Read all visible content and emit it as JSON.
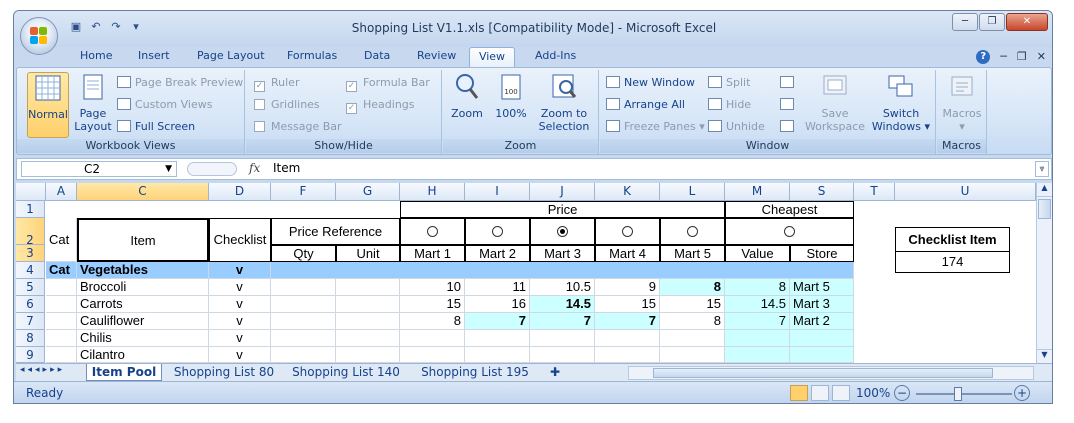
{
  "window": {
    "title": "Shopping List V1.1.xls  [Compatibility Mode] - Microsoft Excel",
    "controls": {
      "minimize": "─",
      "restore": "❐",
      "close": "✕"
    }
  },
  "tabs": [
    "Home",
    "Insert",
    "Page Layout",
    "Formulas",
    "Data",
    "Review",
    "View",
    "Add-Ins"
  ],
  "active_tab": "View",
  "ribbon": {
    "workbook_views": {
      "label": "Workbook Views",
      "normal": "Normal",
      "page_layout": "Page Layout",
      "page_break_preview": "Page Break Preview",
      "custom_views": "Custom Views",
      "full_screen": "Full Screen"
    },
    "show_hide": {
      "label": "Show/Hide",
      "ruler": "Ruler",
      "formula_bar": "Formula Bar",
      "gridlines": "Gridlines",
      "headings": "Headings",
      "message_bar": "Message Bar"
    },
    "zoom": {
      "label": "Zoom",
      "zoom": "Zoom",
      "hundred": "100%",
      "zoom_to_selection": "Zoom to Selection"
    },
    "window": {
      "label": "Window",
      "new_window": "New Window",
      "arrange_all": "Arrange All",
      "freeze_panes": "Freeze Panes",
      "split": "Split",
      "hide": "Hide",
      "unhide": "Unhide",
      "save_workspace": "Save Workspace",
      "switch_windows": "Switch Windows"
    },
    "macros": {
      "label": "Macros",
      "macros": "Macros"
    }
  },
  "formula_bar": {
    "name_box": "C2",
    "fx": "fx",
    "value": "Item"
  },
  "columns": [
    "A",
    "C",
    "D",
    "F",
    "G",
    "H",
    "I",
    "J",
    "K",
    "L",
    "M",
    "S",
    "T",
    "U"
  ],
  "rows": [
    "1",
    "2",
    "3",
    "4",
    "5",
    "6",
    "7",
    "8",
    "9"
  ],
  "grid": {
    "price": "Price",
    "cheapest": "Cheapest",
    "cat": "Cat",
    "item": "Item",
    "checklist": "Checklist",
    "price_reference": "Price Reference",
    "qty": "Qty",
    "unit": "Unit",
    "marts": [
      "Mart 1",
      "Mart 2",
      "Mart 3",
      "Mart 4",
      "Mart 5"
    ],
    "value": "Value",
    "store": "Store",
    "category_row": {
      "cat": "Cat",
      "name": "Vegetables",
      "check": "v"
    },
    "items": [
      {
        "name": "Broccoli",
        "check": "v",
        "prices": [
          "10",
          "11",
          "10.5",
          "9",
          "8"
        ],
        "value": "8",
        "store": "Mart 5"
      },
      {
        "name": "Carrots",
        "check": "v",
        "prices": [
          "15",
          "16",
          "14.5",
          "15",
          "15"
        ],
        "value": "14.5",
        "store": "Mart 3"
      },
      {
        "name": "Cauliflower",
        "check": "v",
        "prices": [
          "8",
          "7",
          "7",
          "7",
          "8"
        ],
        "value": "7",
        "store": "Mart 2"
      },
      {
        "name": "Chilis",
        "check": "v",
        "prices": [
          "",
          "",
          "",
          "",
          ""
        ],
        "value": "",
        "store": ""
      },
      {
        "name": "Cilantro",
        "check": "v",
        "prices": [
          "",
          "",
          "",
          "",
          ""
        ],
        "value": "",
        "store": ""
      }
    ],
    "checklist_item_label": "Checklist Item",
    "checklist_item_value": "174"
  },
  "sheet_tabs": [
    "Item Pool",
    "Shopping List 80",
    "Shopping List 140",
    "Shopping List 195"
  ],
  "status": {
    "ready": "Ready",
    "zoom": "100%"
  },
  "colors": {
    "highlight_cyan": "#ccffff",
    "header_blue": "#99ccff",
    "ribbon": "#d7e6f7"
  }
}
